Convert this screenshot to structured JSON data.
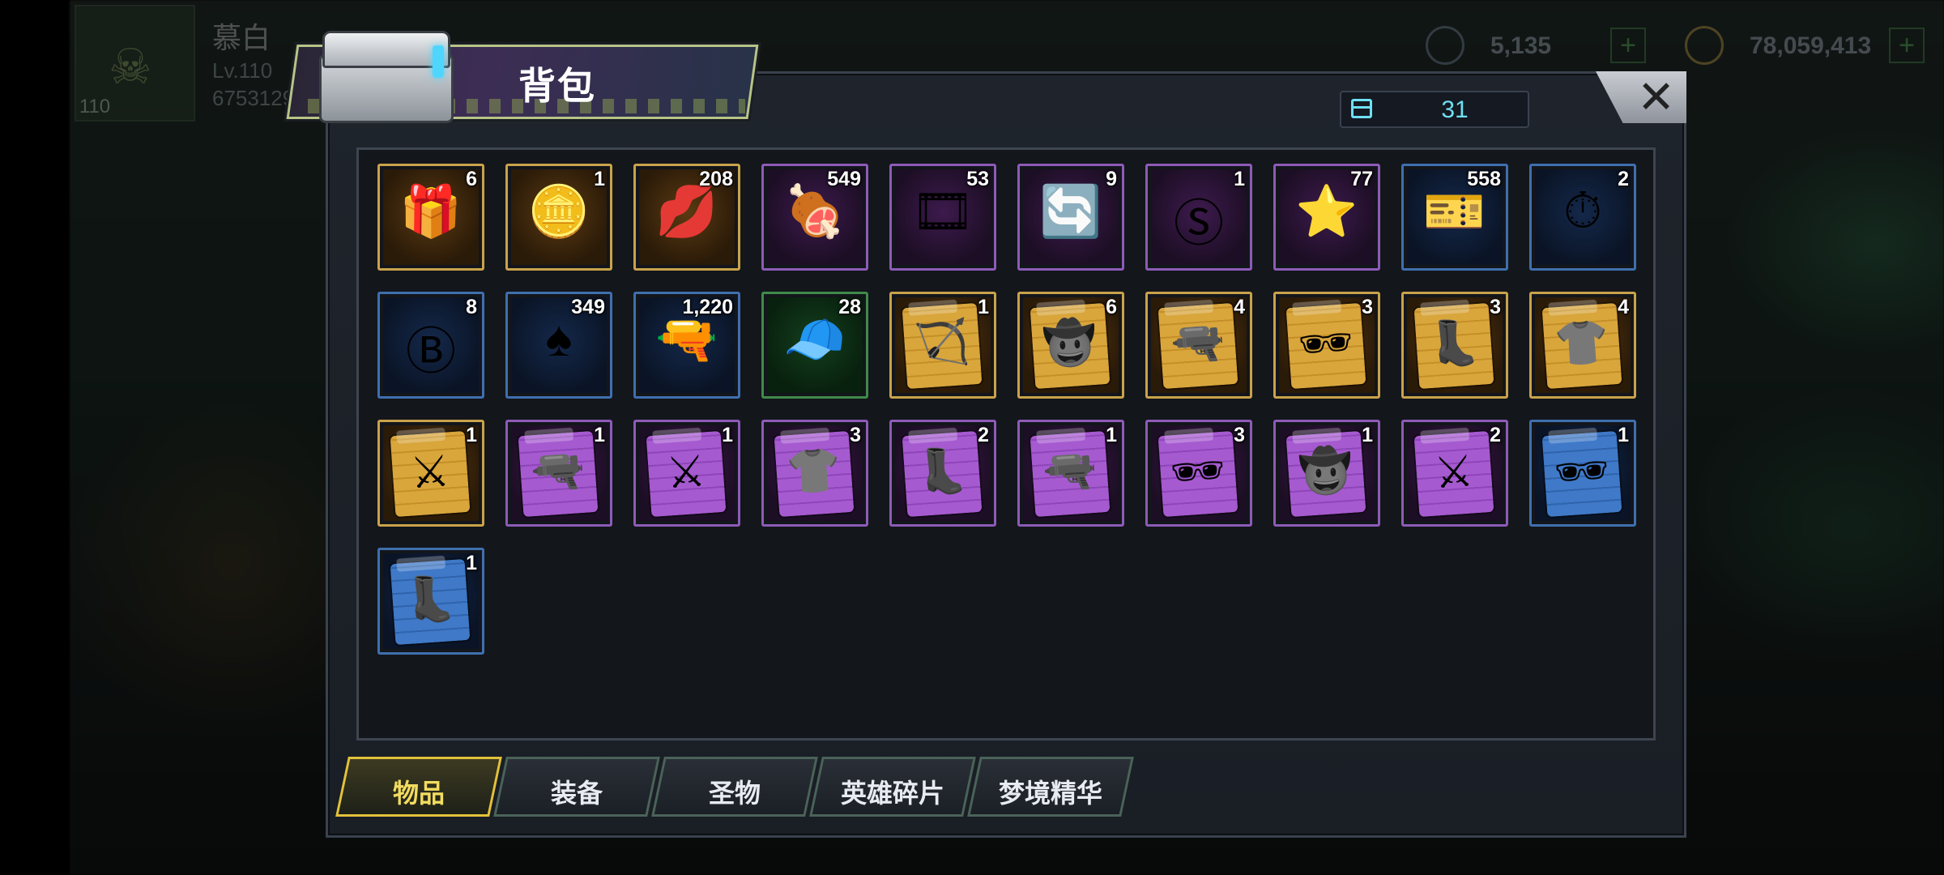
{
  "player": {
    "name": "慕白",
    "level_text": "Lv.110",
    "id_text": "6753129",
    "badge_level": "110"
  },
  "currencies": [
    {
      "name": "gems",
      "value": "5,135"
    },
    {
      "name": "gold",
      "value": "78,059,413"
    }
  ],
  "bag": {
    "title": "背包",
    "capacity": "31",
    "close_label": "✕"
  },
  "items": [
    {
      "name": "purple-chest",
      "count": "6",
      "rarity": "gold",
      "glyph": "🎁"
    },
    {
      "name": "gold-coin",
      "count": "1",
      "rarity": "gold",
      "glyph": "🪙"
    },
    {
      "name": "lips-bottlecap",
      "count": "208",
      "rarity": "gold",
      "glyph": "💋"
    },
    {
      "name": "ham-drumstick",
      "count": "549",
      "rarity": "purple",
      "glyph": "🍖"
    },
    {
      "name": "film-reel",
      "count": "53",
      "rarity": "purple",
      "glyph": "🎞"
    },
    {
      "name": "arrow-device",
      "count": "9",
      "rarity": "purple",
      "glyph": "🔄"
    },
    {
      "name": "s-bottlecap",
      "count": "1",
      "rarity": "purple",
      "glyph": "Ⓢ"
    },
    {
      "name": "police-badge",
      "count": "77",
      "rarity": "purple",
      "glyph": "⭐"
    },
    {
      "name": "cinema-ticket",
      "count": "558",
      "rarity": "blue",
      "glyph": "🎫"
    },
    {
      "name": "stopwatch-token",
      "count": "2",
      "rarity": "blue",
      "glyph": "⏱"
    },
    {
      "name": "b-bottlecap",
      "count": "8",
      "rarity": "blue",
      "glyph": "Ⓑ"
    },
    {
      "name": "poker-chip",
      "count": "349",
      "rarity": "blue",
      "glyph": "♠"
    },
    {
      "name": "bullet",
      "count": "1,220",
      "rarity": "blue",
      "glyph": "🔫"
    },
    {
      "name": "green-cap",
      "count": "28",
      "rarity": "green",
      "glyph": "🧢"
    },
    {
      "name": "gold-bow-card",
      "count": "1",
      "rarity": "gold",
      "glyph": "🏹",
      "card": "gold"
    },
    {
      "name": "gold-hat-card",
      "count": "6",
      "rarity": "gold",
      "glyph": "🤠",
      "card": "gold"
    },
    {
      "name": "gold-pistol-card",
      "count": "4",
      "rarity": "gold",
      "glyph": "🔫",
      "card": "gold"
    },
    {
      "name": "gold-glasses-card",
      "count": "3",
      "rarity": "gold",
      "glyph": "🕶",
      "card": "gold"
    },
    {
      "name": "gold-boots-card",
      "count": "3",
      "rarity": "gold",
      "glyph": "👢",
      "card": "gold"
    },
    {
      "name": "gold-shirt-card",
      "count": "4",
      "rarity": "gold",
      "glyph": "👕",
      "card": "gold"
    },
    {
      "name": "gold-swords-card",
      "count": "1",
      "rarity": "gold",
      "glyph": "⚔",
      "card": "gold"
    },
    {
      "name": "purple-pistol-card",
      "count": "1",
      "rarity": "purple",
      "glyph": "🔫",
      "card": "purple"
    },
    {
      "name": "purple-swords-card",
      "count": "1",
      "rarity": "purple",
      "glyph": "⚔",
      "card": "purple"
    },
    {
      "name": "purple-shirt-card",
      "count": "3",
      "rarity": "purple",
      "glyph": "👕",
      "card": "purple"
    },
    {
      "name": "purple-boots-card",
      "count": "2",
      "rarity": "purple",
      "glyph": "👢",
      "card": "purple"
    },
    {
      "name": "purple-pistol-card-2",
      "count": "1",
      "rarity": "purple",
      "glyph": "🔫",
      "card": "purple"
    },
    {
      "name": "purple-glasses-card",
      "count": "3",
      "rarity": "purple",
      "glyph": "🕶",
      "card": "purple"
    },
    {
      "name": "purple-hat-card",
      "count": "1",
      "rarity": "purple",
      "glyph": "🤠",
      "card": "purple"
    },
    {
      "name": "purple-swords-card-2",
      "count": "2",
      "rarity": "purple",
      "glyph": "⚔",
      "card": "purple"
    },
    {
      "name": "blue-glasses-card",
      "count": "1",
      "rarity": "blue",
      "glyph": "🕶",
      "card": "blue"
    },
    {
      "name": "blue-boots-card",
      "count": "1",
      "rarity": "blue",
      "glyph": "👢",
      "card": "blue"
    }
  ],
  "tabs": [
    {
      "label": "物品",
      "active": true
    },
    {
      "label": "装备",
      "active": false
    },
    {
      "label": "圣物",
      "active": false
    },
    {
      "label": "英雄碎片",
      "active": false
    },
    {
      "label": "梦境精华",
      "active": false
    }
  ],
  "colors": {
    "rarity_gold": "#c9a24a",
    "rarity_purple": "#8d5bb8",
    "rarity_blue": "#3f6fae",
    "rarity_green": "#3f8a4a",
    "accent_cyan": "#6fe0f2",
    "tab_active": "#e3c23a"
  }
}
